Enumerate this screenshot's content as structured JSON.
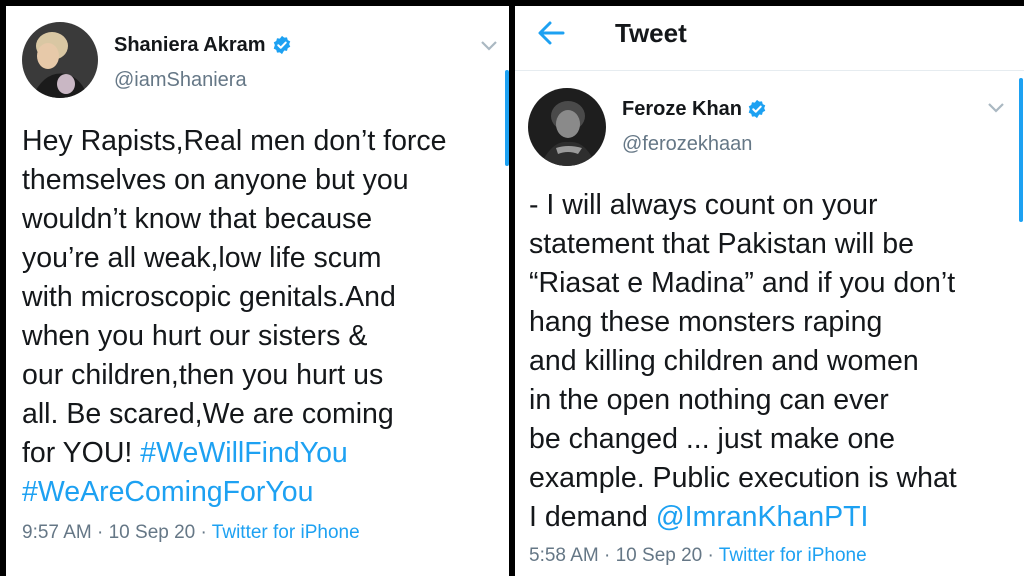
{
  "left_tweet": {
    "name": "Shaniera Akram",
    "handle": "@iamShaniera",
    "lines": [
      "Hey Rapists,Real men don’t force",
      "themselves on anyone but you",
      "wouldn’t know that because",
      "you’re all weak,low life scum",
      "with microscopic genitals.And",
      "when you hurt our sisters &",
      "our children,then you hurt us",
      "all. Be scared,We are coming"
    ],
    "last_line_text": "for YOU! ",
    "hashtag1": "#WeWillFindYou",
    "hashtag2": "#WeAreComingForYou",
    "time": "9:57 AM",
    "sep": " · ",
    "date": "10 Sep 20",
    "source": "Twitter for iPhone"
  },
  "right_tweet": {
    "header_title": "Tweet",
    "name": "Feroze Khan",
    "handle": "@ferozekhaan",
    "lines": [
      "- I will always count on your",
      "statement that Pakistan will be",
      "“Riasat e Madina” and if you don’t",
      "hang these monsters raping",
      "and killing children and women",
      "in the open nothing can ever",
      "be changed ... just make one",
      "example. Public execution is what"
    ],
    "last_line_text": "I demand ",
    "mention": "@ImranKhanPTI",
    "time": "5:58 AM",
    "sep": " · ",
    "date": "10 Sep 20",
    "source": "Twitter for iPhone"
  },
  "icons": {
    "verified": "verified-badge-icon",
    "chevron": "chevron-down-icon",
    "back": "back-arrow-icon"
  },
  "colors": {
    "link": "#1da1f2",
    "text": "#14171a",
    "muted": "#657786"
  }
}
